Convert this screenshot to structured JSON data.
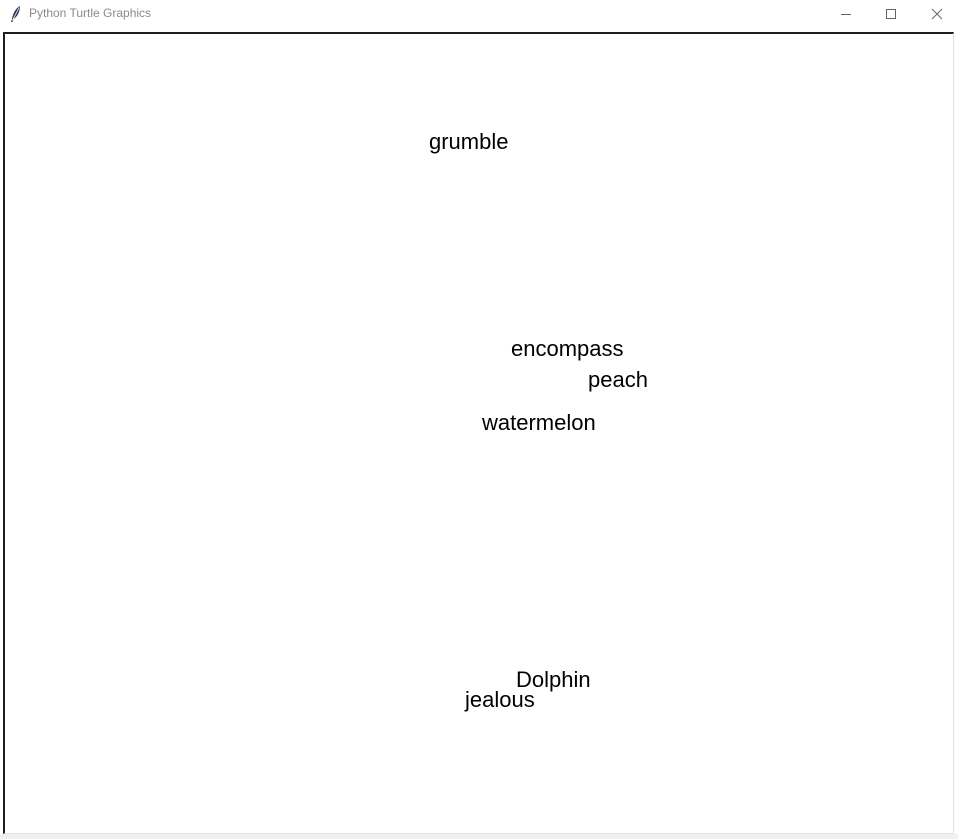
{
  "window": {
    "title": "Python Turtle Graphics",
    "icon": "feather-icon",
    "controls": {
      "minimize": "minimize-icon",
      "maximize": "maximize-icon",
      "close": "close-icon"
    }
  },
  "canvas": {
    "background": "#ffffff",
    "text_color": "#000000",
    "words": {
      "grumble": "grumble",
      "encompass": "encompass",
      "peach": "peach",
      "watermelon": "watermelon",
      "dolphin": "Dolphin",
      "jealous": "jealous"
    }
  }
}
